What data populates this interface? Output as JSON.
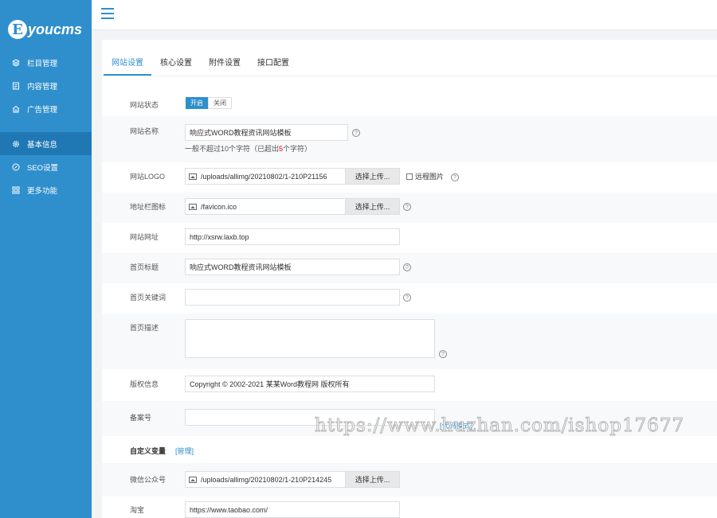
{
  "logo": {
    "initial": "E",
    "text": "youcms"
  },
  "sidebar": {
    "items": [
      {
        "label": "栏目管理",
        "icon": "layers-icon"
      },
      {
        "label": "内容管理",
        "icon": "document-icon"
      },
      {
        "label": "广告管理",
        "icon": "home-icon"
      },
      {
        "label": "基本信息",
        "icon": "gear-icon",
        "active": true
      },
      {
        "label": "SEO设置",
        "icon": "compass-icon"
      },
      {
        "label": "更多功能",
        "icon": "grid-icon"
      }
    ]
  },
  "tabs": [
    "网站设置",
    "核心设置",
    "附件设置",
    "接口配置"
  ],
  "form": {
    "status": {
      "label": "网站状态",
      "on": "开启",
      "off": "关闭"
    },
    "site_name": {
      "label": "网站名称",
      "value": "响应式WORD教程资讯网站模板",
      "hint_pre": "一般不超过10个字符（已超出",
      "hint_num": "5",
      "hint_post": "个字符）"
    },
    "logo": {
      "label": "网站LOGO",
      "value": "/uploads/allimg/20210802/1-210P21156",
      "button": "选择上传...",
      "remote": "远程图片"
    },
    "favicon": {
      "label": "地址栏图标",
      "value": "/favicon.ico",
      "button": "选择上传..."
    },
    "url": {
      "label": "网站网址",
      "value": "http://xsrw.laxb.top"
    },
    "home_title": {
      "label": "首页标题",
      "value": "响应式WORD教程资讯网站模板"
    },
    "home_keywords": {
      "label": "首页关键词",
      "value": ""
    },
    "home_desc": {
      "label": "首页描述",
      "value": ""
    },
    "copyright": {
      "label": "版权信息",
      "value": "Copyright © 2002-2021 某某Word教程网 版权所有"
    },
    "icp": {
      "label": "备案号",
      "value": "",
      "code_link": "[代码模式]"
    },
    "custom_vars": {
      "label": "自定义变量",
      "manage": "[管理]"
    },
    "wechat": {
      "label": "微信公众号",
      "value": "/uploads/allimg/20210802/1-210P214245",
      "button": "选择上传..."
    },
    "taobao": {
      "label": "淘宝",
      "value": "https://www.taobao.com/"
    }
  },
  "help_glyph": "?",
  "watermark": "https://www.huzhan.com/ishop17677"
}
